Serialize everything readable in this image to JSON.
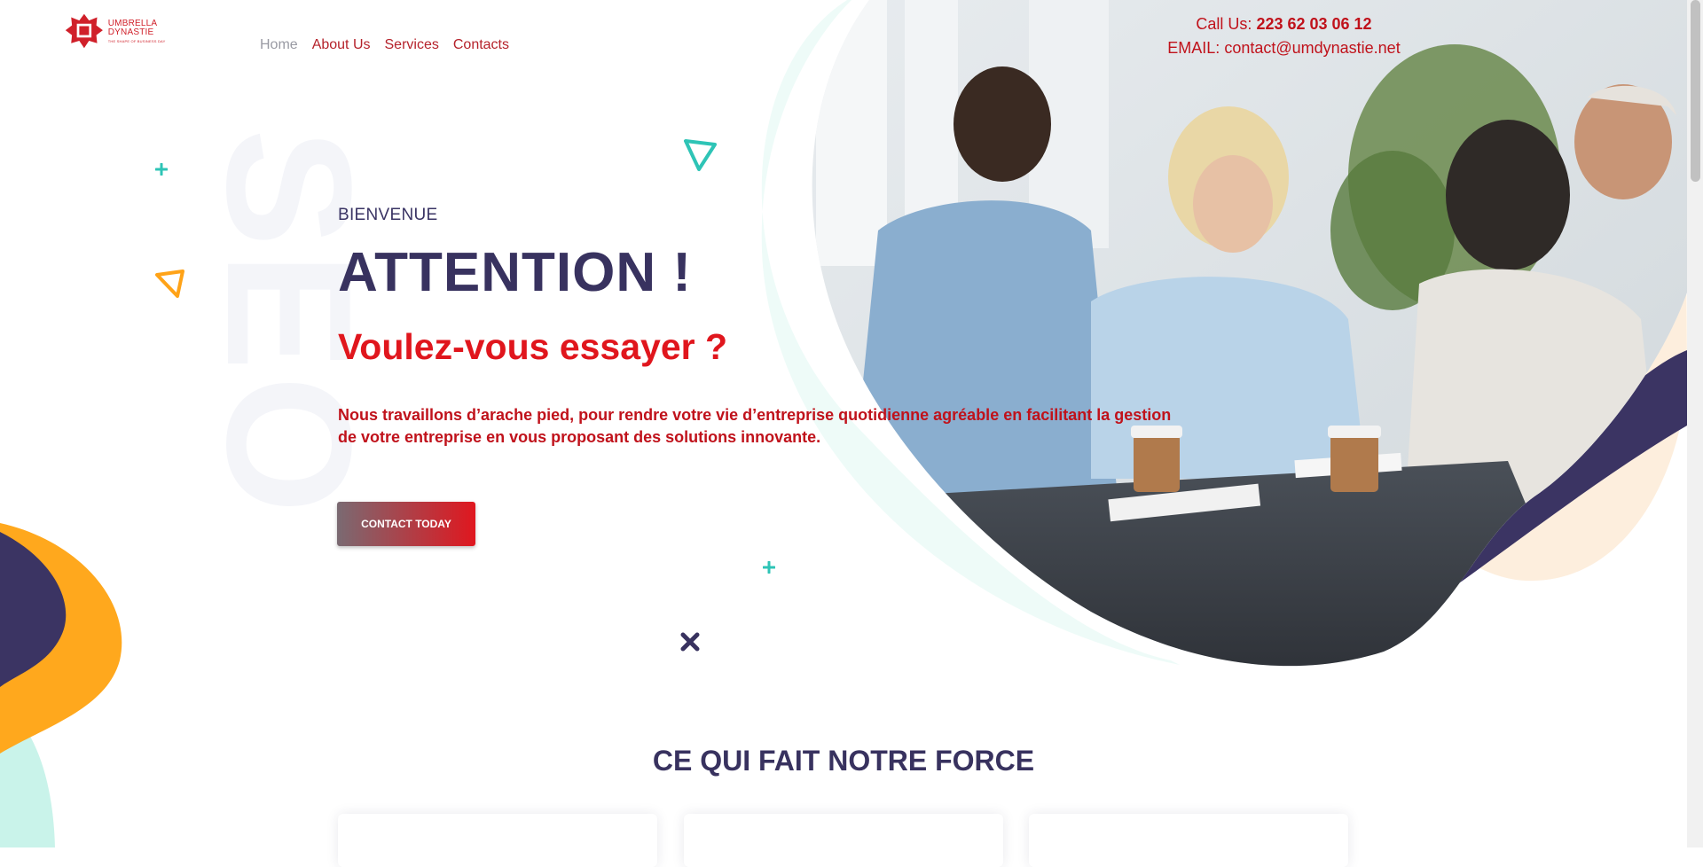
{
  "brand": {
    "name": "UMBRELLA DYNASTIE",
    "tagline": "THE SHAPE OF BUSINESS DAY",
    "colors": {
      "red": "#e0161d",
      "navy": "#38325f",
      "orange": "#ffa318",
      "teal": "#2ec4b6"
    }
  },
  "nav": {
    "items": [
      {
        "label": "Home",
        "active": true
      },
      {
        "label": "About Us",
        "active": false
      },
      {
        "label": "Services",
        "active": false
      },
      {
        "label": "Contacts",
        "active": false
      }
    ]
  },
  "contact": {
    "phone_label": "Call Us: ",
    "phone": "223 62 03 06 12",
    "email_label": "EMAIL: ",
    "email": "contact@umdynastie.net"
  },
  "hero": {
    "watermark": "SEO",
    "welcome": "BIENVENUE",
    "headline": "ATTENTION !",
    "subheadline": "Voulez-vous essayer ?",
    "description": "Nous travaillons d’arache pied, pour rendre votre vie d’entreprise quotidienne agréable en facilitant la gestion de votre entreprise en vous proposant des solutions innovante.",
    "cta_label": "CONTACT TODAY",
    "image_desc": "team-meeting-photo"
  },
  "strengths": {
    "title": "CE QUI FAIT NOTRE FORCE"
  },
  "icons": [
    "umbrella-logo-icon",
    "teal-plus-icon",
    "orange-triangle-icon",
    "teal-triangle-icon",
    "navy-x-icon"
  ]
}
